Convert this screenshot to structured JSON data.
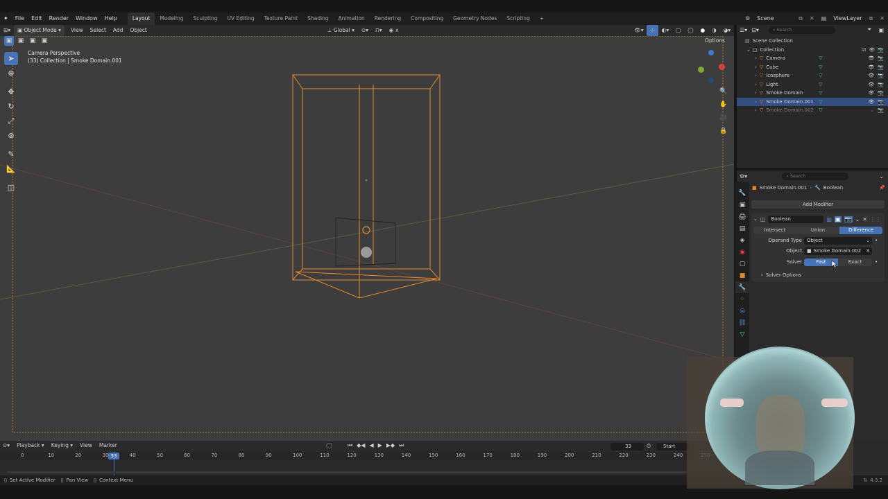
{
  "menubar": {
    "items": [
      "File",
      "Edit",
      "Render",
      "Window",
      "Help"
    ],
    "workspaces": [
      "Layout",
      "Modeling",
      "Sculpting",
      "UV Editing",
      "Texture Paint",
      "Shading",
      "Animation",
      "Rendering",
      "Compositing",
      "Geometry Nodes",
      "Scripting"
    ],
    "active_workspace": "Layout",
    "add_workspace": "+",
    "scene_label": "Scene",
    "viewlayer_label": "ViewLayer"
  },
  "viewport_header": {
    "mode": "Object Mode",
    "menus": [
      "View",
      "Select",
      "Add",
      "Object"
    ],
    "transform_orientation": "Global",
    "options_label": "Options"
  },
  "viewport": {
    "perspective_label": "Camera Perspective",
    "object_info": "(33) Collection | Smoke Domain.001"
  },
  "outliner": {
    "search_placeholder": "Search",
    "scene_collection": "Scene Collection",
    "collection": "Collection",
    "objects": [
      {
        "name": "Camera",
        "selected": false,
        "hidden": false
      },
      {
        "name": "Cube",
        "selected": false,
        "hidden": false
      },
      {
        "name": "Icosphere",
        "selected": false,
        "hidden": false
      },
      {
        "name": "Light",
        "selected": false,
        "hidden": false
      },
      {
        "name": "Smoke Domain",
        "selected": false,
        "hidden": false
      },
      {
        "name": "Smoke Domain.001",
        "selected": true,
        "hidden": false
      },
      {
        "name": "Smoke Domain.002",
        "selected": false,
        "hidden": true
      }
    ]
  },
  "properties": {
    "search_placeholder": "Search",
    "breadcrumb_object": "Smoke Domain.001",
    "breadcrumb_sep": "›",
    "breadcrumb_modifier": "Boolean",
    "add_modifier": "Add Modifier",
    "modifier_name": "Boolean",
    "operations": [
      "Intersect",
      "Union",
      "Difference"
    ],
    "active_operation": "Difference",
    "operand_type_label": "Operand Type",
    "operand_type_value": "Object",
    "object_label": "Object",
    "object_value": "Smoke Domain.002",
    "solver_label": "Solver",
    "solver_options": [
      "Fast",
      "Exact"
    ],
    "active_solver": "Fast",
    "solver_options_panel": "Solver Options"
  },
  "timeline": {
    "menus": [
      "Playback",
      "Keying",
      "View",
      "Marker"
    ],
    "current_frame": "33",
    "start_label": "Start",
    "ticks": [
      "0",
      "10",
      "20",
      "30",
      "40",
      "50",
      "60",
      "70",
      "80",
      "90",
      "100",
      "110",
      "120",
      "130",
      "140",
      "150",
      "160",
      "170",
      "180",
      "190",
      "200",
      "210",
      "220",
      "230",
      "240",
      "250"
    ],
    "playhead_label": "33"
  },
  "statusbar": {
    "hints": [
      "Set Active Modifier",
      "Pan View",
      "Context Menu"
    ],
    "version": "4.3.2"
  },
  "colors": {
    "selection_orange": "#e58a2b",
    "accent_blue": "#4772b3",
    "viewport_bg": "#3d3d3d"
  }
}
